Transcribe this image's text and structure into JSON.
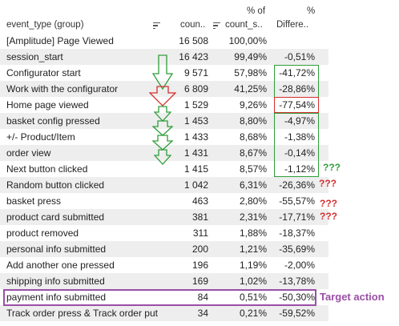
{
  "headers": {
    "event_type": "event_type (group)",
    "count": "coun..",
    "pct_top": "% of",
    "pct_bottom": "count_s..",
    "diff_top": "%",
    "diff_bottom": "Differe.."
  },
  "rows": [
    {
      "name": "[Amplitude] Page Viewed",
      "count": "16 508",
      "pct": "100,00%",
      "diff": ""
    },
    {
      "name": "session_start",
      "count": "16 423",
      "pct": "99,49%",
      "diff": "-0,51%"
    },
    {
      "name": "Configurator start",
      "count": "9 571",
      "pct": "57,98%",
      "diff": "-41,72%"
    },
    {
      "name": "Work with the configurator",
      "count": "6 809",
      "pct": "41,25%",
      "diff": "-28,86%"
    },
    {
      "name": "Home page viewed",
      "count": "1 529",
      "pct": "9,26%",
      "diff": "-77,54%"
    },
    {
      "name": "basket config pressed",
      "count": "1 453",
      "pct": "8,80%",
      "diff": "-4,97%"
    },
    {
      "name": "+/- Product/Item",
      "count": "1 433",
      "pct": "8,68%",
      "diff": "-1,38%"
    },
    {
      "name": "order view",
      "count": "1 431",
      "pct": "8,67%",
      "diff": "-0,14%"
    },
    {
      "name": "Next button clicked",
      "count": "1 415",
      "pct": "8,57%",
      "diff": "-1,12%"
    },
    {
      "name": "Random button clicked",
      "count": "1 042",
      "pct": "6,31%",
      "diff": "-26,36%"
    },
    {
      "name": "basket press",
      "count": "463",
      "pct": "2,80%",
      "diff": "-55,57%"
    },
    {
      "name": "product card submitted",
      "count": "381",
      "pct": "2,31%",
      "diff": "-17,71%"
    },
    {
      "name": "product removed",
      "count": "311",
      "pct": "1,88%",
      "diff": "-18,37%"
    },
    {
      "name": "personal info submitted",
      "count": "200",
      "pct": "1,21%",
      "diff": "-35,69%"
    },
    {
      "name": "Add another one pressed",
      "count": "196",
      "pct": "1,19%",
      "diff": "-2,00%"
    },
    {
      "name": "shipping info submitted",
      "count": "169",
      "pct": "1,02%",
      "diff": "-13,78%"
    },
    {
      "name": "payment info submitted",
      "count": "84",
      "pct": "0,51%",
      "diff": "-50,30%"
    },
    {
      "name": "Track order press & Track order put",
      "count": "34",
      "pct": "0,21%",
      "diff": "-59,52%"
    }
  ],
  "annotations": {
    "qq_green": "???",
    "qq_red_1": "???",
    "qq_red_2": "???",
    "qq_red_3": "???",
    "target_label": "Target action"
  },
  "colors": {
    "green": "#2e9e3a",
    "red": "#d62e2e",
    "purple": "#9a4fa6",
    "row_alt": "#eeeeee"
  }
}
